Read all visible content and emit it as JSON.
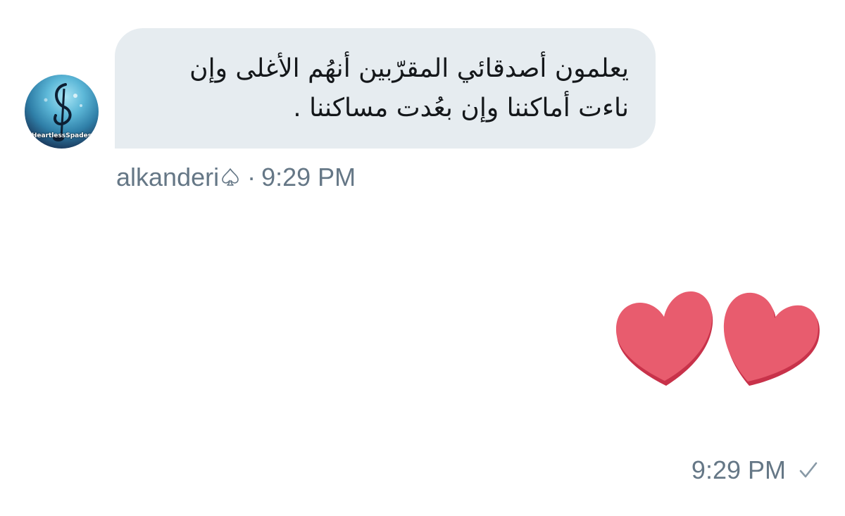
{
  "conversation": {
    "incoming_message": {
      "avatar": {
        "icon": "music-clef-avatar",
        "caption": "HeartlessSpades"
      },
      "lines": [
        "يعلمون أصدقائي المقرّبين أنهُم الأغلى وإن",
        "ناءت أماكننا وإن بعُدت مساكننا ."
      ],
      "sender_name": "alkanderi",
      "sender_badge_icon": "spade-icon",
      "separator": "·",
      "time": "9:29 PM"
    },
    "outgoing_message": {
      "content_icon": "two-hearts-emoji",
      "time": "9:29 PM",
      "status_icon": "check-icon"
    }
  },
  "colors": {
    "bubble_background": "#e6ecf0",
    "text_primary": "#14171a",
    "text_secondary": "#657786",
    "heart": "#e85c6e"
  }
}
